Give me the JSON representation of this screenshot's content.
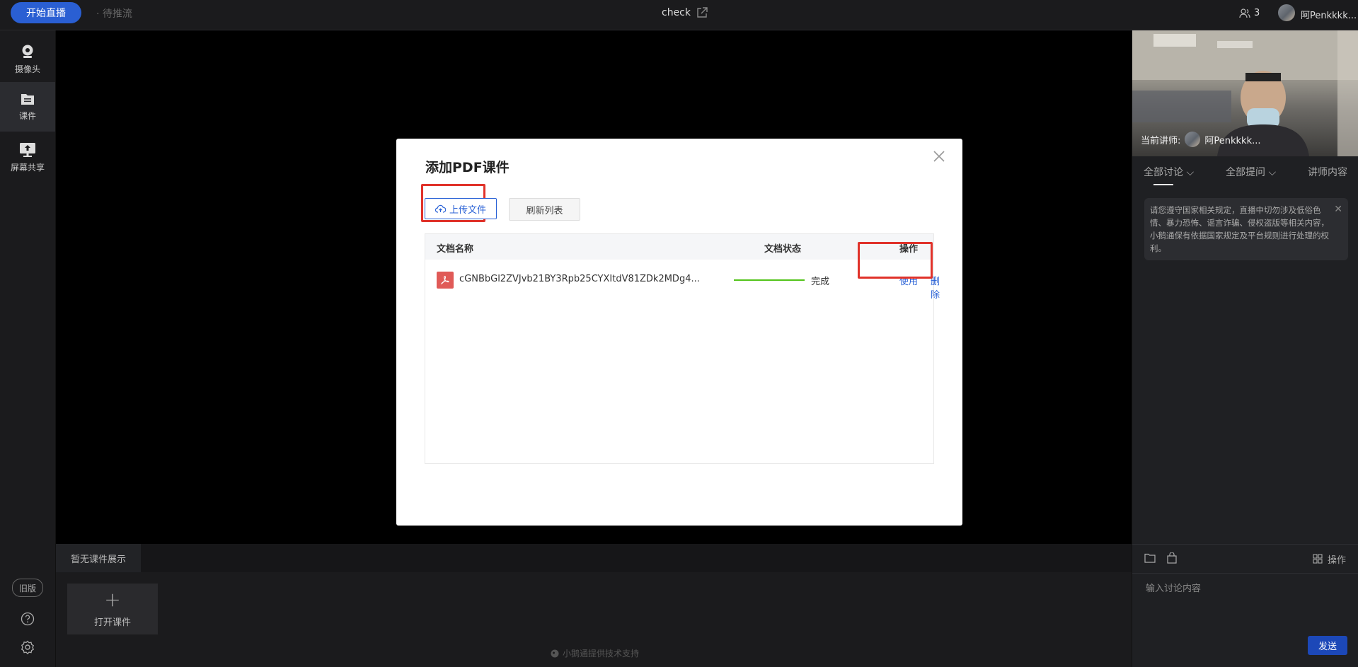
{
  "topbar": {
    "start_live": "开始直播",
    "stream_status": "· 待推流",
    "room_title": "check",
    "viewer_count": "3",
    "username": "阿Penkkkk..."
  },
  "sidebar": {
    "items": [
      {
        "label": "摄像头",
        "icon": "camera-icon"
      },
      {
        "label": "课件",
        "icon": "folder-icon"
      },
      {
        "label": "屏幕共享",
        "icon": "screen-share-icon"
      }
    ],
    "old_version": "旧版"
  },
  "course_strip": {
    "no_course": "暂无课件展示",
    "open_course": "打开课件",
    "tech_support": "小鹅通提供技术支持"
  },
  "right_panel": {
    "lecturer_label": "当前讲师:",
    "lecturer_name": "阿Penkkkk...",
    "tabs": [
      "全部讨论",
      "全部提问",
      "讲师内容"
    ],
    "notice": "请您遵守国家相关规定，直播中切勿涉及低俗色情、暴力恐怖、谣言诈骗、侵权盗版等相关内容，小鹅通保有依据国家规定及平台规则进行处理的权利。",
    "toolbar_action": "操作",
    "input_placeholder": "输入讨论内容",
    "send": "发送"
  },
  "modal": {
    "title": "添加PDF课件",
    "upload": "上传文件",
    "refresh": "刷新列表",
    "columns": {
      "name": "文档名称",
      "status": "文档状态",
      "ops": "操作"
    },
    "rows": [
      {
        "file_name": "cGNBbGl2ZVJvb21BY3Rpb25CYXItdV81ZDk2MDg4...",
        "progress": 1.0,
        "status": "完成",
        "use": "使用",
        "delete": "删除"
      }
    ]
  },
  "colors": {
    "primary": "#2a62d6",
    "start_button": "#2a5fd3",
    "highlight": "#e0322a",
    "progress_complete": "#52c41a",
    "pdf_icon": "#e05a57"
  }
}
